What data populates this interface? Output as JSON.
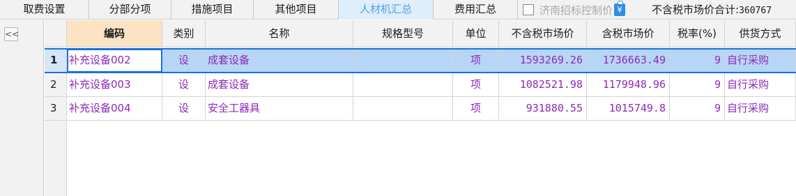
{
  "tabs": [
    {
      "label": "取费设置",
      "active": false
    },
    {
      "label": "分部分项",
      "active": false
    },
    {
      "label": "措施项目",
      "active": false
    },
    {
      "label": "其他项目",
      "active": false
    },
    {
      "label": "人材机汇总",
      "active": true
    },
    {
      "label": "费用汇总",
      "active": false
    }
  ],
  "toolbar": {
    "checkbox_label": "济南招标控制价",
    "checkbox_checked": false,
    "coin_icon": "¥",
    "total_label": "不含税市场价合计:",
    "total_value": "360767"
  },
  "gutter": {
    "collapse_icon": "<<"
  },
  "table": {
    "columns": [
      "编码",
      "类别",
      "名称",
      "规格型号",
      "单位",
      "不含税市场价",
      "含税市场价",
      "税率(%)",
      "供货方式"
    ],
    "sorted_column": "编码",
    "rows": [
      {
        "idx": "1",
        "code": "补充设备002",
        "category": "设",
        "name": "成套设备",
        "spec": "",
        "unit": "项",
        "price_ex": "1593269.26",
        "price_in": "1736663.49",
        "tax": "9",
        "supply": "自行采购",
        "selected": true
      },
      {
        "idx": "2",
        "code": "补充设备003",
        "category": "设",
        "name": "成套设备",
        "spec": "",
        "unit": "项",
        "price_ex": "1082521.98",
        "price_in": "1179948.96",
        "tax": "9",
        "supply": "自行采购",
        "selected": false
      },
      {
        "idx": "3",
        "code": "补充设备004",
        "category": "设",
        "name": "安全工器具",
        "spec": "",
        "unit": "项",
        "price_ex": "931880.55",
        "price_in": "1015749.8",
        "tax": "9",
        "supply": "自行采购",
        "selected": false
      }
    ]
  }
}
